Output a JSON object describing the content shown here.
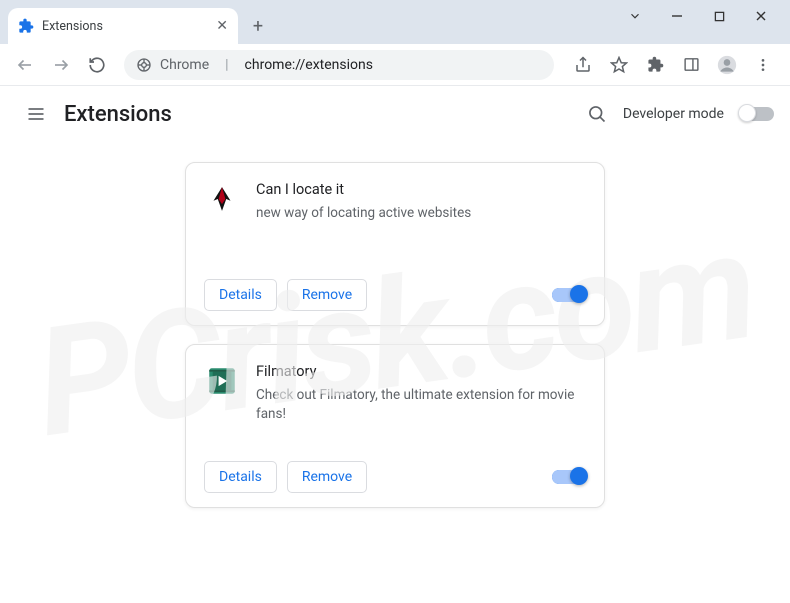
{
  "window": {
    "tab_title": "Extensions"
  },
  "omnibox": {
    "scheme": "Chrome",
    "url": "chrome://extensions"
  },
  "page": {
    "title": "Extensions",
    "developer_mode_label": "Developer mode"
  },
  "buttons": {
    "details": "Details",
    "remove": "Remove"
  },
  "extensions": [
    {
      "name": "Can I locate it",
      "description": "new way of locating active websites",
      "enabled": true,
      "icon": "wings"
    },
    {
      "name": "Filmatory",
      "description": "Check out Filmatory, the ultimate extension for movie fans!",
      "enabled": true,
      "icon": "film"
    }
  ],
  "watermark": "PCrisk.com"
}
